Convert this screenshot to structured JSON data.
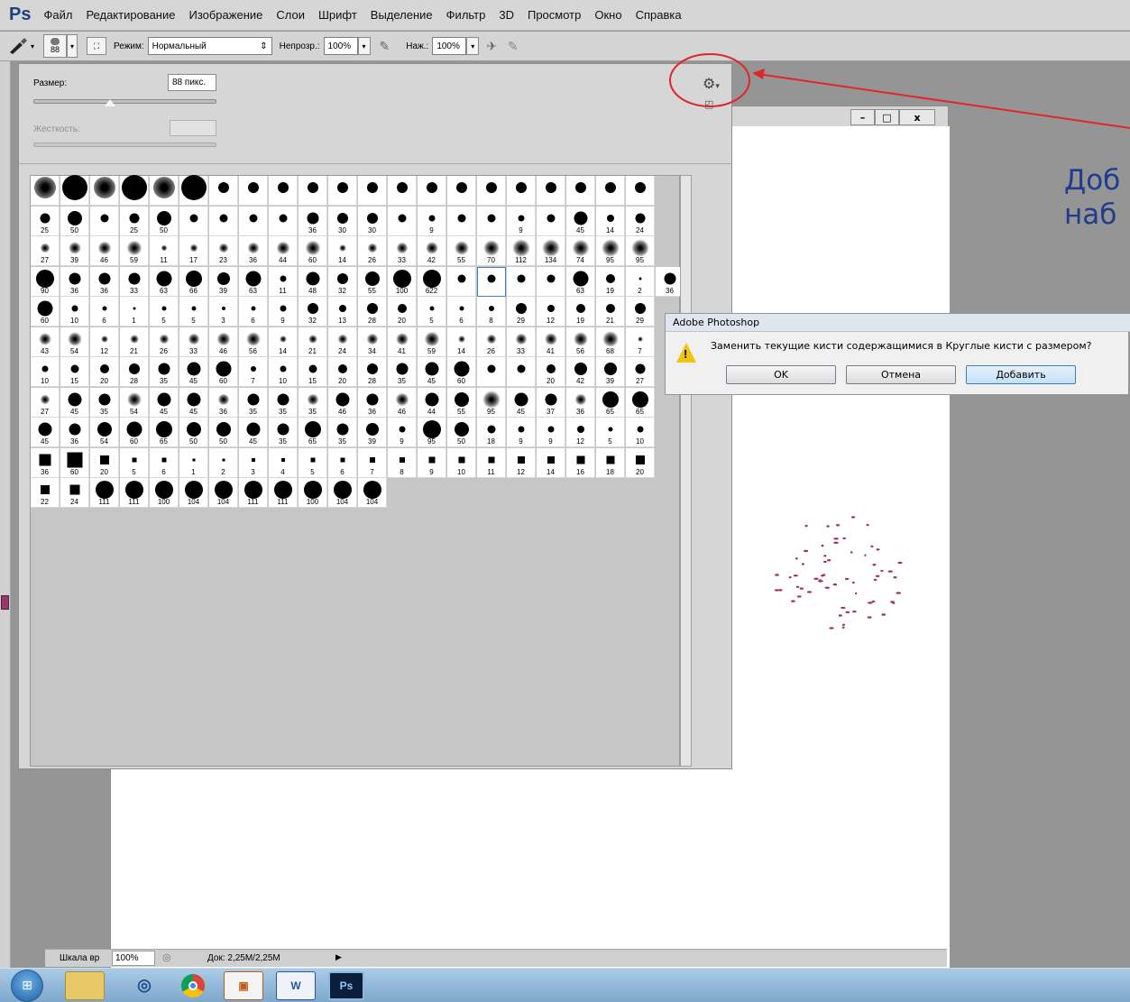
{
  "app": {
    "logo": "Ps"
  },
  "menu": [
    "Файл",
    "Редактирование",
    "Изображение",
    "Слои",
    "Шрифт",
    "Выделение",
    "Фильтр",
    "3D",
    "Просмотр",
    "Окно",
    "Справка"
  ],
  "options": {
    "brush_size_badge": "88",
    "mode_label": "Режим:",
    "mode_value": "Нормальный",
    "opacity_label": "Непрозр.:",
    "opacity_value": "100%",
    "flow_label": "Наж.:",
    "flow_value": "100%"
  },
  "brush_panel": {
    "size_label": "Размер:",
    "size_value": "88 пикс.",
    "hardness_label": "Жесткость:",
    "size_slider_pct": 42,
    "gear_icon": "gear-icon",
    "grid_numbers": [
      [
        "",
        "",
        "",
        "",
        "",
        "",
        "",
        "",
        "",
        "",
        "",
        "",
        "",
        "",
        "",
        "",
        "",
        "",
        "",
        "",
        ""
      ],
      [
        "25",
        "50",
        "",
        "25",
        "50",
        "",
        "",
        "",
        "",
        "36",
        "30",
        "30",
        "",
        "9",
        "",
        "",
        "9",
        "",
        "45",
        "14",
        "24"
      ],
      [
        "27",
        "39",
        "46",
        "59",
        "11",
        "17",
        "23",
        "36",
        "44",
        "60",
        "14",
        "26",
        "33",
        "42",
        "55",
        "70",
        "112",
        "134",
        "74",
        "95",
        "95"
      ],
      [
        "90",
        "36",
        "36",
        "33",
        "63",
        "66",
        "39",
        "63",
        "11",
        "48",
        "32",
        "55",
        "100",
        "622",
        "",
        "",
        "",
        "",
        "63",
        "19",
        "2",
        "36"
      ],
      [
        "60",
        "10",
        "6",
        "1",
        "5",
        "5",
        "3",
        "6",
        "9",
        "32",
        "13",
        "28",
        "20",
        "5",
        "6",
        "8",
        "29",
        "12",
        "19",
        "21",
        "29"
      ],
      [
        "43",
        "54",
        "12",
        "21",
        "26",
        "33",
        "46",
        "56",
        "14",
        "21",
        "24",
        "34",
        "41",
        "59",
        "14",
        "26",
        "33",
        "41",
        "56",
        "68",
        "7"
      ],
      [
        "10",
        "15",
        "20",
        "28",
        "35",
        "45",
        "60",
        "7",
        "10",
        "15",
        "20",
        "28",
        "35",
        "45",
        "60",
        "",
        "",
        "20",
        "42",
        "39",
        "27"
      ],
      [
        "27",
        "45",
        "35",
        "54",
        "45",
        "45",
        "36",
        "35",
        "35",
        "35",
        "46",
        "36",
        "46",
        "44",
        "55",
        "95",
        "45",
        "37",
        "36",
        "65",
        "65"
      ],
      [
        "45",
        "36",
        "54",
        "60",
        "65",
        "50",
        "50",
        "45",
        "35",
        "65",
        "35",
        "39",
        "9",
        "95",
        "50",
        "18",
        "9",
        "9",
        "12",
        "5",
        "10"
      ],
      [
        "36",
        "60",
        "20",
        "5",
        "6",
        "1",
        "2",
        "3",
        "4",
        "5",
        "6",
        "7",
        "8",
        "9",
        "10",
        "11",
        "12",
        "14",
        "16",
        "18",
        "20"
      ],
      [
        "22",
        "24",
        "111",
        "111",
        "100",
        "104",
        "104",
        "111",
        "111",
        "100",
        "104",
        "104"
      ]
    ]
  },
  "document": {
    "win_minimize": "–",
    "win_maximize": "□",
    "win_close": "x"
  },
  "status": {
    "panel_tab": "Шкала вр",
    "zoom": "100%",
    "doc_info": "Док: 2,25M/2,25M",
    "play_glyph": "▶"
  },
  "dialog": {
    "title": "Adobe Photoshop",
    "message": "Заменить текущие кисти содержащимися в Круглые кисти с размером?",
    "ok": "OK",
    "cancel": "Отмена",
    "add": "Добавить",
    "warning_glyph": "!"
  },
  "annotation": {
    "line1": "Доб",
    "line2": "наб"
  },
  "taskbar": {
    "ps_label": "Ps",
    "word_label": "W"
  },
  "colors": {
    "accent_blue": "#1e3f7a",
    "annotation_red": "#e0262b",
    "dot_magenta": "#a0326e"
  }
}
